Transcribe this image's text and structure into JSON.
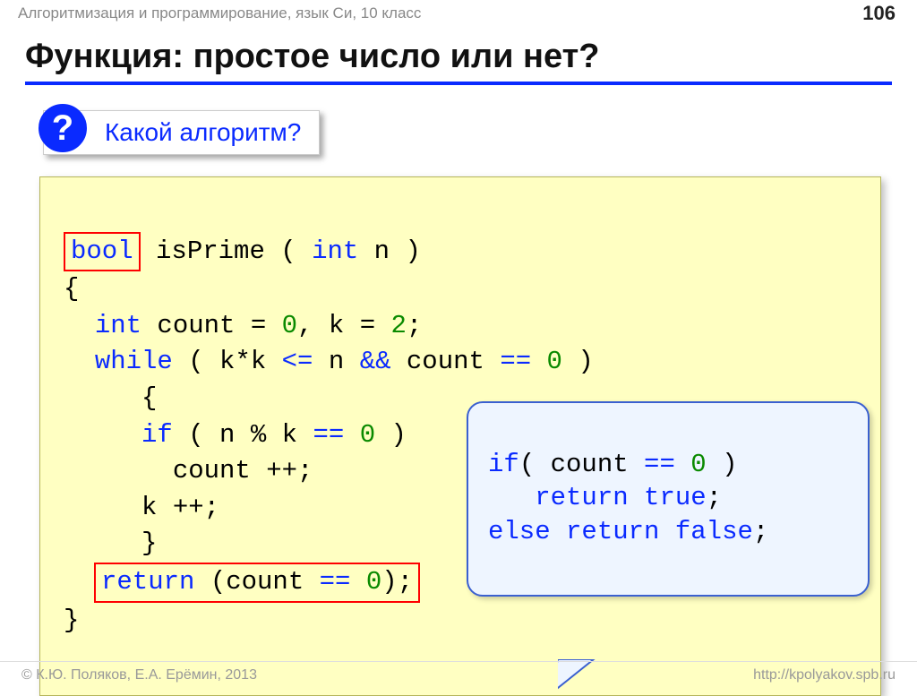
{
  "header": {
    "subject": "Алгоритмизация и программирование, язык Си, 10 класс",
    "page_number": "106"
  },
  "title": "Функция: простое число или нет?",
  "question": {
    "mark": "?",
    "text": "Какой алгоритм?"
  },
  "code": {
    "bool_kw": "bool",
    "sig1": " isPrime ( ",
    "int_kw": "int",
    "sig2": " n )",
    "brace_open": "{",
    "line2a": "  ",
    "line2b": " count = ",
    "zero": "0",
    "line2c": ", k = ",
    "two": "2",
    "semicolon": ";",
    "while_kw": "while",
    "line3a": " ( k*k ",
    "lte": "<=",
    "line3b": " n ",
    "and": "&&",
    "line3c": " count ",
    "eqeq": "==",
    "line3d": " )",
    "brace_open2": "     {",
    "if_kw": "if",
    "line5a": " ( n % k ",
    "line5b": " )",
    "line6": "       count ++;",
    "line7": "     k ++;",
    "brace_close2": "     }",
    "return_kw": "return",
    "return_expr": " (count ",
    "return_end": ");",
    "brace_close": "}"
  },
  "callout": {
    "line1a": "if",
    "line1b": "( count ",
    "line1c": " )",
    "line2a": "   ",
    "line2_return": "return",
    "line2_true": " true",
    "line3_else": "else",
    "line3_return": " return",
    "line3_false": " false"
  },
  "footer": {
    "left": "© К.Ю. Поляков, Е.А. Ерёмин, 2013",
    "right": "http://kpolyakov.spb.ru"
  }
}
